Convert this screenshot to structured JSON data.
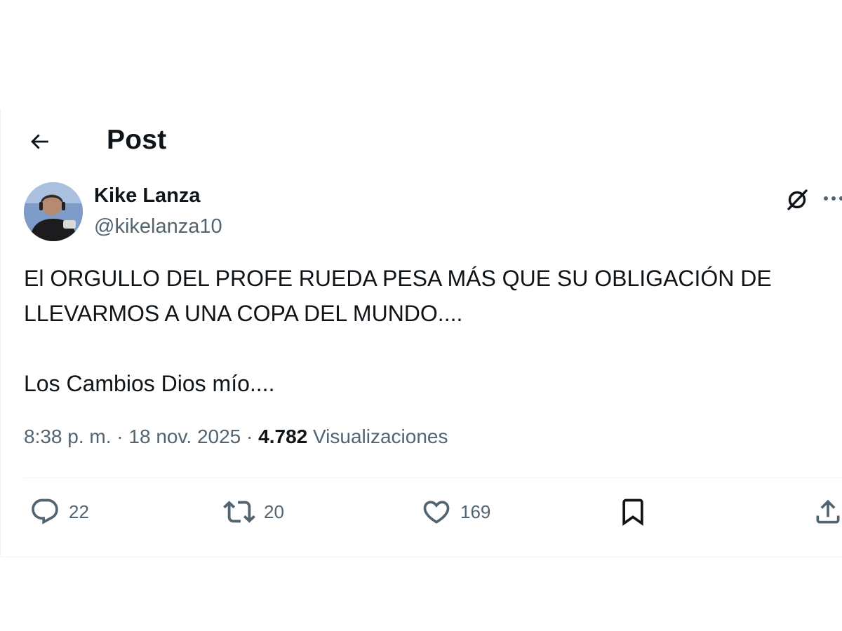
{
  "header": {
    "title": "Post"
  },
  "author": {
    "display_name": "Kike Lanza",
    "handle": "@kikelanza10"
  },
  "tweet": {
    "text": "El ORGULLO DEL PROFE RUEDA PESA MÁS QUE SU OBLIGACIÓN DE\nLLEVARMOS A UNA COPA DEL MUNDO....\n\nLos Cambios Dios mío...."
  },
  "meta": {
    "time": "8:38 p. m.",
    "separator": "·",
    "date": "18 nov. 2025",
    "views_count": "4.782",
    "views_label": "Visualizaciones"
  },
  "actions": {
    "replies": "22",
    "retweets": "20",
    "likes": "169"
  },
  "icons": {
    "back": "arrow-left-icon",
    "grok": "grok-icon",
    "more": "more-dots-icon",
    "reply": "speech-bubble-icon",
    "retweet": "retweet-icon",
    "like": "heart-icon",
    "bookmark": "bookmark-icon",
    "share": "share-upload-icon"
  },
  "colors": {
    "text": "#0f1419",
    "secondary": "#536471",
    "divider": "#eff3f4"
  }
}
